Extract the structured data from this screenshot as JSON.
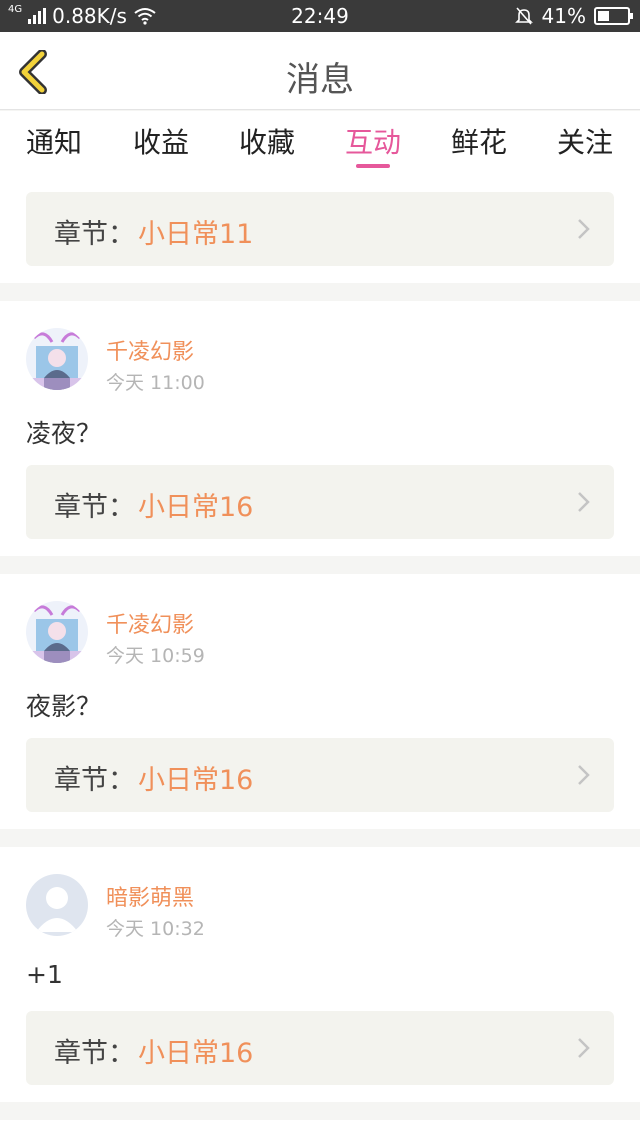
{
  "status_bar": {
    "network_tag": "4G",
    "speed": "0.88K/s",
    "time": "22:49",
    "battery": "41%",
    "battery_level": 0.41,
    "icons": [
      "signal-icon",
      "wifi-icon",
      "bell-off-icon",
      "battery-icon"
    ]
  },
  "header": {
    "title": "消息",
    "back_icon": "chevron-left-icon",
    "accent": "#f2d23a"
  },
  "tabs": [
    {
      "label": "通知",
      "active": false
    },
    {
      "label": "收益",
      "active": false
    },
    {
      "label": "收藏",
      "active": false
    },
    {
      "label": "互动",
      "active": true
    },
    {
      "label": "鲜花",
      "active": false
    },
    {
      "label": "关注",
      "active": false
    }
  ],
  "colors": {
    "active_tab": "#e6589b",
    "username": "#f0905a",
    "chapter_name": "#f0905a",
    "timestamp": "#b5b5b5"
  },
  "messages": [
    {
      "chapter_label": "章节：",
      "chapter_name": "小日常11"
    },
    {
      "user": "千凌幻影",
      "time": "今天 11:00",
      "comment": "凌夜？",
      "avatar": "anime-avatar",
      "chapter_label": "章节：",
      "chapter_name": "小日常16"
    },
    {
      "user": "千凌幻影",
      "time": "今天 10:59",
      "comment": "夜影？",
      "avatar": "anime-avatar",
      "chapter_label": "章节：",
      "chapter_name": "小日常16"
    },
    {
      "user": "暗影萌黑",
      "time": "今天 10:32",
      "comment": "+1",
      "avatar": "default-avatar",
      "chapter_label": "章节：",
      "chapter_name": "小日常16"
    }
  ]
}
